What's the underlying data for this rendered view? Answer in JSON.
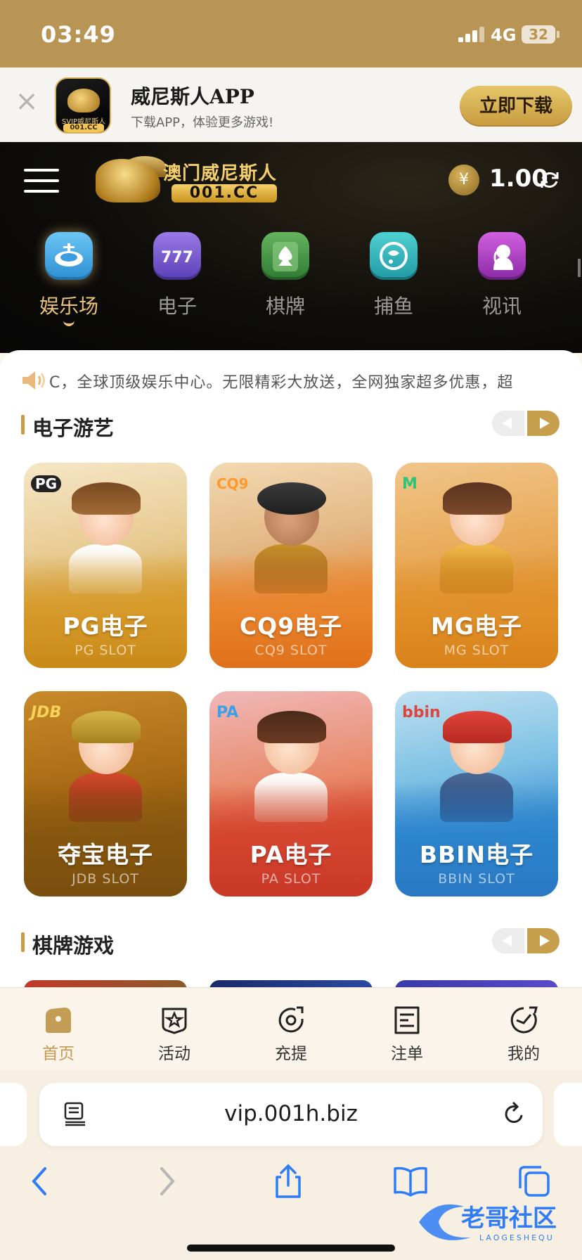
{
  "status_bar": {
    "time": "03:49",
    "network": "4G",
    "battery": "32"
  },
  "app_banner": {
    "title": "威尼斯人APP",
    "subtitle": "下载APP，体验更多游戏!",
    "download_label": "立即下载",
    "logo_tag_top": "SVIP威尼斯人",
    "logo_tag_bottom": "001.CC"
  },
  "header": {
    "logo_name": "澳门威尼斯人",
    "logo_domain": "001.CC",
    "currency_symbol": "¥",
    "balance": "1.00"
  },
  "nav_tabs": [
    {
      "label": "娱乐场",
      "icon": "casino-chip-icon",
      "active": true
    },
    {
      "label": "电子",
      "icon": "slot-777-icon",
      "active": false
    },
    {
      "label": "棋牌",
      "icon": "spade-card-icon",
      "active": false
    },
    {
      "label": "捕鱼",
      "icon": "fish-icon",
      "active": false
    },
    {
      "label": "视讯",
      "icon": "live-video-woman-icon",
      "active": false
    }
  ],
  "announcement": "C，全球顶级娱乐中心。无限精彩大放送，全网独家超多优惠，超",
  "sections": {
    "electronic": {
      "title": "电子游艺",
      "cards": [
        {
          "brand": "PG",
          "title": "PG电子",
          "subtitle": "PG SLOT"
        },
        {
          "brand": "CQ9",
          "title": "CQ9电子",
          "subtitle": "CQ9 SLOT"
        },
        {
          "brand": "M",
          "title": "MG电子",
          "subtitle": "MG SLOT"
        },
        {
          "brand": "JDB",
          "title": "夺宝电子",
          "subtitle": "JDB SLOT"
        },
        {
          "brand": "PA",
          "title": "PA电子",
          "subtitle": "PA SLOT"
        },
        {
          "brand": "bbin",
          "title": "BBIN电子",
          "subtitle": "BBIN SLOT"
        }
      ]
    },
    "card_games": {
      "title": "棋牌游戏"
    }
  },
  "tabbar": [
    {
      "label": "首页",
      "icon": "home-icon",
      "active": true
    },
    {
      "label": "活动",
      "icon": "star-box-icon",
      "active": false
    },
    {
      "label": "充提",
      "icon": "deposit-target-icon",
      "active": false
    },
    {
      "label": "注单",
      "icon": "bet-slip-icon",
      "active": false
    },
    {
      "label": "我的",
      "icon": "profile-icon",
      "active": false
    }
  ],
  "browser": {
    "url": "vip.001h.biz"
  },
  "watermark": {
    "cn": "老哥社区",
    "en": "LAOGESHEQU"
  },
  "colors": {
    "gold": "#c79c45",
    "status_bar": "#b89554",
    "header_bg": "#0d0c0a"
  }
}
